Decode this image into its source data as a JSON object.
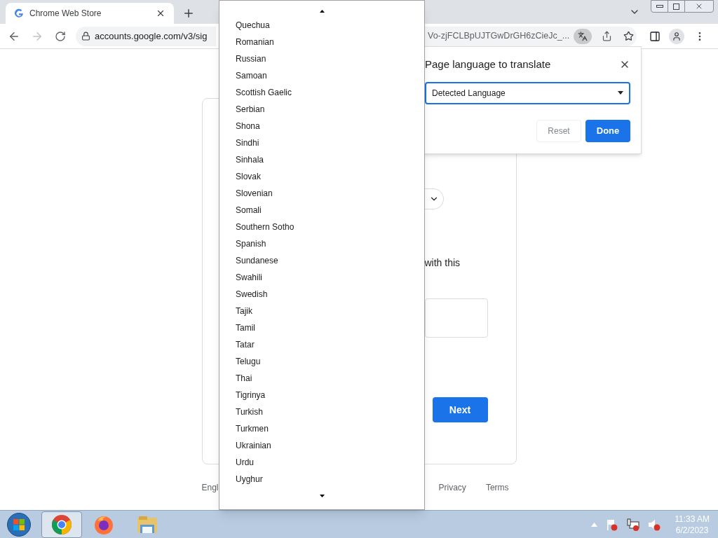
{
  "browser": {
    "tab": {
      "title": "Chrome Web Store"
    },
    "address": {
      "url_start": "accounts.google.com/v3/sig",
      "url_end": "Vo-zjFCLBpUJTGwDrGH6zCieJc_..."
    }
  },
  "page": {
    "text_fragment": "with this",
    "next_button": "Next",
    "footer": [
      "Engl",
      "Privacy",
      "Terms"
    ]
  },
  "translate_popup": {
    "title": "Page language to translate",
    "language_select": "Detected Language",
    "buttons": [
      {
        "label": "Reset",
        "kind": "secondary"
      },
      {
        "label": "Done",
        "kind": "primary"
      }
    ]
  },
  "language_list": [
    "Quechua",
    "Romanian",
    "Russian",
    "Samoan",
    "Scottish Gaelic",
    "Serbian",
    "Shona",
    "Sindhi",
    "Sinhala",
    "Slovak",
    "Slovenian",
    "Somali",
    "Southern Sotho",
    "Spanish",
    "Sundanese",
    "Swahili",
    "Swedish",
    "Tajik",
    "Tamil",
    "Tatar",
    "Telugu",
    "Thai",
    "Tigrinya",
    "Turkish",
    "Turkmen",
    "Ukrainian",
    "Urdu",
    "Uyghur"
  ],
  "taskbar": {
    "apps": [
      {
        "kind": "chrome",
        "selected": true
      },
      {
        "kind": "firefox",
        "selected": false
      },
      {
        "kind": "explorer",
        "selected": false
      }
    ],
    "time": "11:33 AM",
    "date": "6/2/2023"
  }
}
